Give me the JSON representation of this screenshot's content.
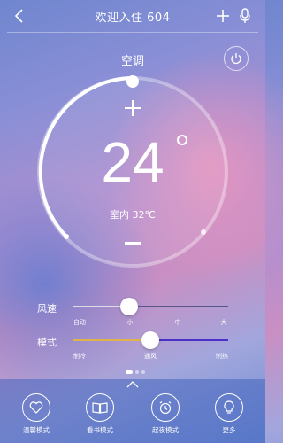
{
  "header": {
    "title": "欢迎入住 604",
    "back_icon": "chevron-left-icon",
    "add_icon": "plus-icon",
    "mic_icon": "microphone-icon"
  },
  "device": {
    "name": "空调",
    "power_icon": "power-icon"
  },
  "thermostat": {
    "set_temperature": "24",
    "degree_symbol": "°",
    "indoor": "室内 32℃",
    "increase_icon": "plus-icon",
    "decrease_icon": "minus-icon"
  },
  "fan_speed": {
    "label": "风速",
    "options": [
      "自动",
      "小",
      "中",
      "大"
    ],
    "selected": "小"
  },
  "mode": {
    "label": "模式",
    "options": [
      "制冷",
      "通风",
      "制热"
    ],
    "selected": "通风"
  },
  "pager": {
    "count": 3,
    "active": 0
  },
  "scenes": [
    {
      "label": "温馨模式",
      "icon": "heart-icon"
    },
    {
      "label": "看书模式",
      "icon": "book-icon"
    },
    {
      "label": "起夜模式",
      "icon": "alarm-clock-icon"
    },
    {
      "label": "更多",
      "icon": "lightbulb-icon"
    }
  ],
  "colors": {
    "mode_cool": "#e0b24a",
    "mode_heat": "#4a2fc9"
  }
}
